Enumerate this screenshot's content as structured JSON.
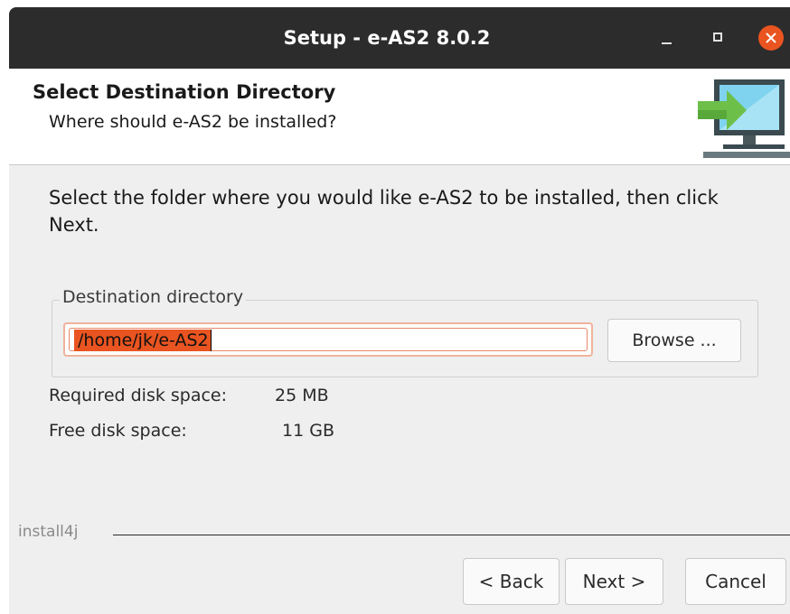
{
  "window": {
    "title": "Setup - e-AS2 8.0.2"
  },
  "header": {
    "title": "Select Destination Directory",
    "subtitle": "Where should e-AS2 be installed?",
    "icon": "install-monitor-icon"
  },
  "body": {
    "intro": "Select the folder where you would like e-AS2 to be installed, then click Next.",
    "destination": {
      "legend": "Destination directory",
      "value": "/home/jk/e-AS2",
      "browse_label": "Browse ..."
    },
    "disk": {
      "required_label": "Required disk space:",
      "required_value": "25 MB",
      "free_label": "Free disk space:",
      "free_value": "11 GB"
    }
  },
  "footer": {
    "brand": "install4j",
    "back_label": "< Back",
    "next_label": "Next >",
    "cancel_label": "Cancel"
  },
  "colors": {
    "accent": "#e95420",
    "titlebar": "#2c2c2c"
  }
}
